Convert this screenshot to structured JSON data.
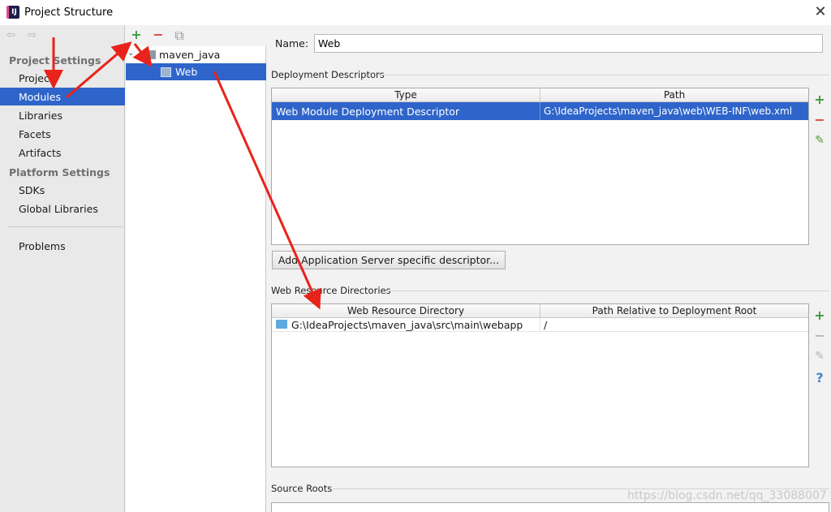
{
  "window": {
    "title": "Project Structure",
    "close_glyph": "✕"
  },
  "nav": {
    "back_glyph": "⇦",
    "forward_glyph": "⇨",
    "sections": [
      {
        "label": "Project Settings",
        "items": [
          "Project",
          "Modules",
          "Libraries",
          "Facets",
          "Artifacts"
        ]
      },
      {
        "label": "Platform Settings",
        "items": [
          "SDKs",
          "Global Libraries"
        ]
      }
    ],
    "bottom_items": [
      "Problems"
    ],
    "selected": "Modules"
  },
  "tree": {
    "toolbar": {
      "add": "+",
      "remove": "−",
      "copy": "⧉"
    },
    "nodes": [
      {
        "label": "maven_java",
        "expanded": true
      },
      {
        "label": "Web",
        "selected": true
      }
    ]
  },
  "detail": {
    "name_label": "Name:",
    "name_value": "Web",
    "deployment": {
      "section_label": "Deployment Descriptors",
      "columns": [
        "Type",
        "Path"
      ],
      "rows": [
        {
          "type": "Web Module Deployment Descriptor",
          "path": "G:\\IdeaProjects\\maven_java\\web\\WEB-INF\\web.xml"
        }
      ],
      "buttons": {
        "add": "+",
        "remove": "−",
        "edit": "✎"
      }
    },
    "add_server_button": "Add Application Server specific descriptor...",
    "web_resources": {
      "section_label": "Web Resource Directories",
      "columns": [
        "Web Resource Directory",
        "Path Relative to Deployment Root"
      ],
      "rows": [
        {
          "directory": "G:\\IdeaProjects\\maven_java\\src\\main\\webapp",
          "relative": "/"
        }
      ],
      "buttons": {
        "add": "+",
        "remove": "−",
        "edit": "✎",
        "help": "?"
      }
    },
    "source_roots_label": "Source Roots"
  },
  "watermark": "https://blog.csdn.net/qq_33088007",
  "colors": {
    "selection": "#2f65ca",
    "add_green": "#3c9c3c",
    "remove_red": "#d9453c",
    "annotation_red": "#e8231b"
  }
}
